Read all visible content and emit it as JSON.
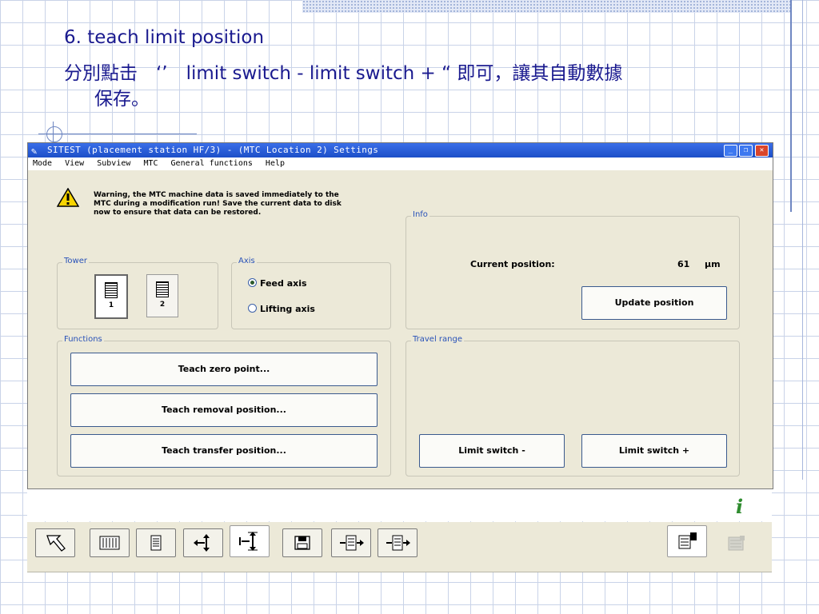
{
  "slide": {
    "title": "6. teach limit position",
    "body_line1": "分別點击　‘’　limit switch -  limit switch + “ 即可，讓其自動數據",
    "body_line2": "保存。"
  },
  "window": {
    "title": "SITEST (placement station HF/3) - (MTC Location 2) Settings",
    "menu": [
      "Mode",
      "View",
      "Subview",
      "MTC",
      "General functions",
      "Help"
    ]
  },
  "warning": {
    "text": "Warning, the MTC machine data is saved immediately to the MTC during a modification run! Save the current data to disk now to ensure that data can be restored."
  },
  "groups": {
    "tower": "Tower",
    "axis": "Axis",
    "info": "Info",
    "functions": "Functions",
    "travel_range": "Travel range"
  },
  "tower_buttons": [
    {
      "label": "1",
      "selected": true
    },
    {
      "label": "2",
      "selected": false
    }
  ],
  "axis_options": [
    {
      "label": "Feed axis",
      "checked": true
    },
    {
      "label": "Lifting axis",
      "checked": false
    }
  ],
  "info": {
    "current_position_label": "Current position:",
    "current_position_value": "61",
    "current_position_unit": "µm",
    "update_button": "Update position"
  },
  "functions": {
    "teach_zero": "Teach zero point...",
    "teach_removal": "Teach removal position...",
    "teach_transfer": "Teach transfer position..."
  },
  "travel": {
    "limit_minus": "Limit switch -",
    "limit_plus": "Limit switch +"
  },
  "toolbar": {
    "icons": [
      "back-arrow-icon",
      "tower-all-icon",
      "tower-single-icon",
      "axis-move-icon",
      "axis-limit-icon",
      "save-disk-icon",
      "tower-1-icon",
      "tower-2-icon",
      "tower-swap-icon",
      "tower-disabled-icon"
    ]
  }
}
